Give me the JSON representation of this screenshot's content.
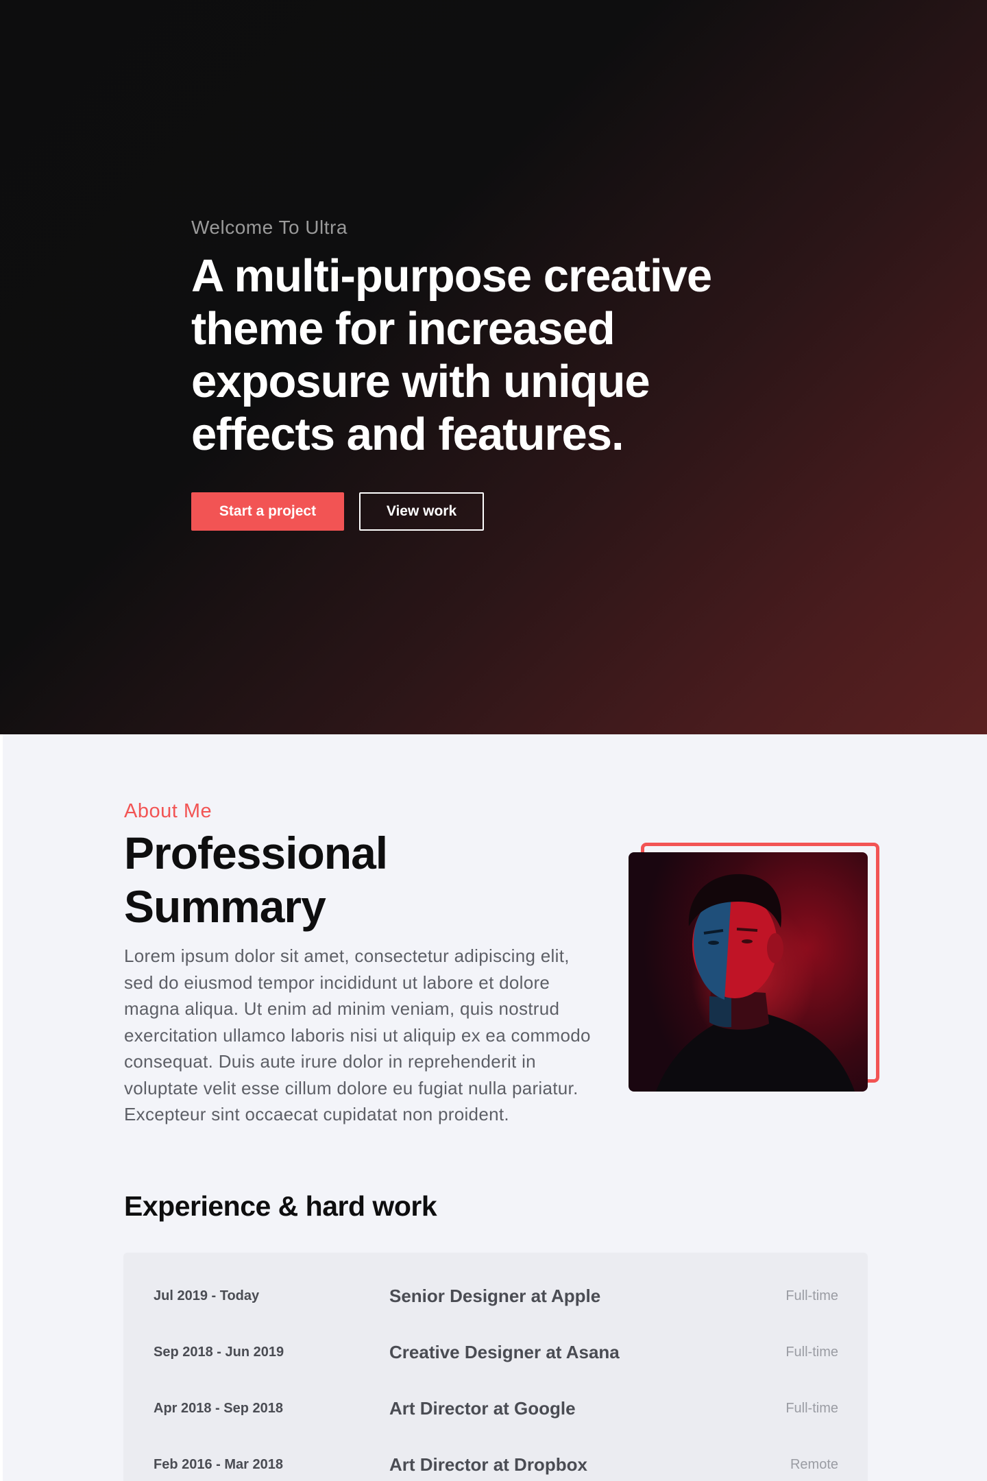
{
  "hero": {
    "eyebrow": "Welcome To Ultra",
    "title": "A multi-purpose creative theme for increased exposure with unique effects and features.",
    "primary_button": "Start a project",
    "secondary_button": "View work"
  },
  "about": {
    "eyebrow": "About Me",
    "title": "Professional Summary",
    "text": "Lorem ipsum dolor sit amet, consectetur adipiscing elit, sed do eiusmod tempor incididunt ut labore et dolore magna aliqua. Ut enim ad minim veniam, quis nostrud exercitation ullamco laboris nisi ut aliquip ex ea commodo consequat. Duis aute irure dolor in reprehenderit in voluptate velit esse cillum dolore eu fugiat nulla pariatur. Excepteur sint occaecat cupidatat non proident."
  },
  "experience": {
    "title": "Experience & hard work",
    "rows": [
      {
        "date": "Jul 2019 - Today",
        "role": "Senior Designer at Apple",
        "type": "Full-time"
      },
      {
        "date": "Sep 2018 - Jun 2019",
        "role": "Creative Designer at Asana",
        "type": "Full-time"
      },
      {
        "date": "Apr 2018 - Sep 2018",
        "role": "Art Director at Google",
        "type": "Full-time"
      },
      {
        "date": "Feb 2016 - Mar 2018",
        "role": "Art Director at Dropbox",
        "type": "Remote"
      }
    ]
  },
  "colors": {
    "accent": "#f25454",
    "hero_dark": "#0e0e0f",
    "section_bg": "#f3f4f9"
  }
}
